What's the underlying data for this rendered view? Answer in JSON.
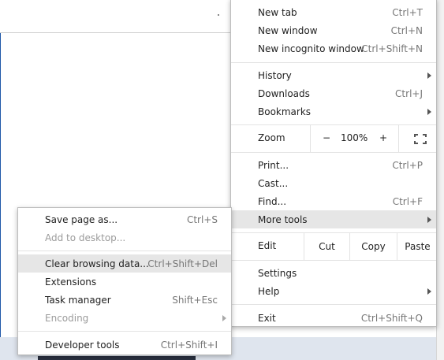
{
  "main_menu": {
    "new_tab": {
      "label": "New tab",
      "shortcut": "Ctrl+T"
    },
    "new_window": {
      "label": "New window",
      "shortcut": "Ctrl+N"
    },
    "new_incognito": {
      "label": "New incognito window",
      "shortcut": "Ctrl+Shift+N"
    },
    "history": {
      "label": "History"
    },
    "downloads": {
      "label": "Downloads",
      "shortcut": "Ctrl+J"
    },
    "bookmarks": {
      "label": "Bookmarks"
    },
    "zoom": {
      "label": "Zoom",
      "minus": "−",
      "value": "100%",
      "plus": "+"
    },
    "print": {
      "label": "Print...",
      "shortcut": "Ctrl+P"
    },
    "cast": {
      "label": "Cast..."
    },
    "find": {
      "label": "Find...",
      "shortcut": "Ctrl+F"
    },
    "more_tools": {
      "label": "More tools"
    },
    "edit": {
      "label": "Edit",
      "cut": "Cut",
      "copy": "Copy",
      "paste": "Paste"
    },
    "settings": {
      "label": "Settings"
    },
    "help": {
      "label": "Help"
    },
    "exit": {
      "label": "Exit",
      "shortcut": "Ctrl+Shift+Q"
    }
  },
  "more_tools_menu": {
    "save_page": {
      "label": "Save page as...",
      "shortcut": "Ctrl+S"
    },
    "add_to_desktop": {
      "label": "Add to desktop..."
    },
    "clear_browsing": {
      "label": "Clear browsing data...",
      "shortcut": "Ctrl+Shift+Del"
    },
    "extensions": {
      "label": "Extensions"
    },
    "task_manager": {
      "label": "Task manager",
      "shortcut": "Shift+Esc"
    },
    "encoding": {
      "label": "Encoding"
    },
    "developer_tools": {
      "label": "Developer tools",
      "shortcut": "Ctrl+Shift+I"
    }
  },
  "icons": {
    "submenu_arrow": "chevron-right-icon",
    "fullscreen": "fullscreen-icon"
  },
  "colors": {
    "hover_bg": "#e6e6e6",
    "shortcut_text": "#777777",
    "disabled_text": "#9b9b9b"
  }
}
